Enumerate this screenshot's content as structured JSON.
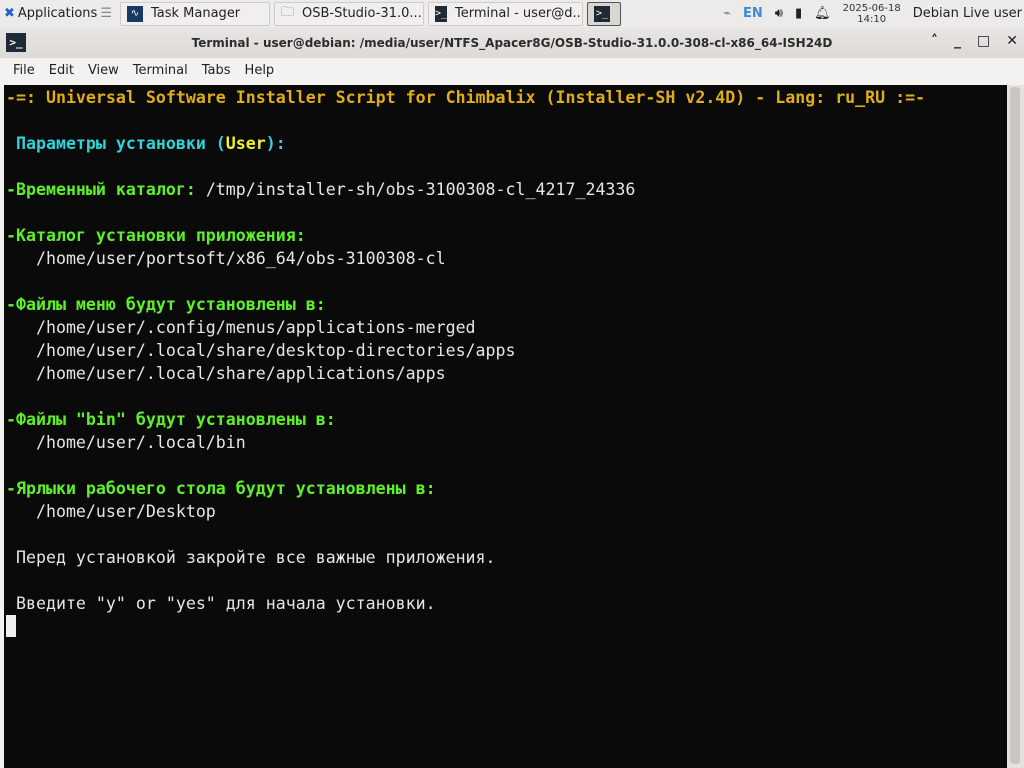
{
  "taskbar": {
    "apps_label": "Applications",
    "tasks": [
      "Task Manager",
      "OSB-Studio-31.0....",
      "Terminal - user@d..."
    ],
    "lang": "EN",
    "date": "2025-06-18",
    "time": "14:10",
    "user": "Debian Live user"
  },
  "window": {
    "title": "Terminal - user@debian: /media/user/NTFS_Apacer8G/OSB-Studio-31.0.0-308-cl-x86_64-ISH24D",
    "menu": [
      "File",
      "Edit",
      "View",
      "Terminal",
      "Tabs",
      "Help"
    ]
  },
  "terminal": {
    "header": "-=: Universal Software Installer Script for Chimbalix (Installer-SH v2.4D) - Lang: ru_RU :=-",
    "params_a": " Параметры установки (",
    "params_user": "User",
    "params_b": "):",
    "tmp_label": "-Временный каталог:",
    "tmp_value": " /tmp/installer-sh/obs-3100308-cl_4217_24336",
    "app_label": "-Каталог установки приложения:",
    "app_value": "   /home/user/portsoft/x86_64/obs-3100308-cl",
    "menu_label": "-Файлы меню будут установлены в:",
    "menu_values": [
      "   /home/user/.config/menus/applications-merged",
      "   /home/user/.local/share/desktop-directories/apps",
      "   /home/user/.local/share/applications/apps"
    ],
    "bin_label": "-Файлы \"bin\" будут установлены в:",
    "bin_value": "   /home/user/.local/bin",
    "desk_label": "-Ярлыки рабочего стола будут установлены в:",
    "desk_value": "   /home/user/Desktop",
    "close_msg": " Перед установкой закройте все важные приложения.",
    "prompt": " Введите \"y\" or \"yes\" для начала установки."
  }
}
